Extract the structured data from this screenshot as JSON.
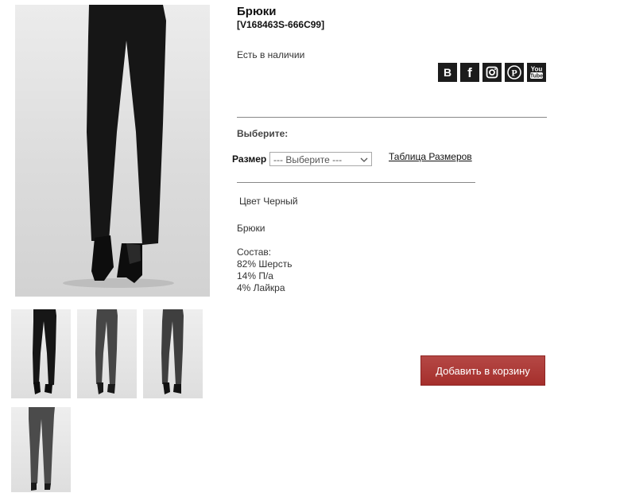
{
  "product": {
    "title": "Брюки",
    "sku": "[V168463S-666C99]",
    "availability": "Есть в наличии",
    "choose_label": "Выберите:",
    "size_label": "Размер",
    "size_selected": "--- Выберите ---",
    "size_table_link": "Таблица Размеров",
    "color_line": "Цвет Черный",
    "description": "Брюки",
    "composition_title": "Состав:",
    "composition": [
      "82% Шерсть",
      "14% П/а",
      "4% Лайкра"
    ],
    "add_to_cart": "Добавить в корзину"
  },
  "social": [
    {
      "icon": "vk-icon",
      "glyph": "В"
    },
    {
      "icon": "facebook-icon",
      "glyph": "f"
    },
    {
      "icon": "instagram-icon",
      "glyph": ""
    },
    {
      "icon": "pinterest-icon",
      "glyph": ""
    },
    {
      "icon": "youtube-icon",
      "glyph": "You Tube"
    }
  ],
  "colors": {
    "cart_button": "#a8312e",
    "social_bg": "#1c1c1c",
    "divider": "#888888"
  }
}
